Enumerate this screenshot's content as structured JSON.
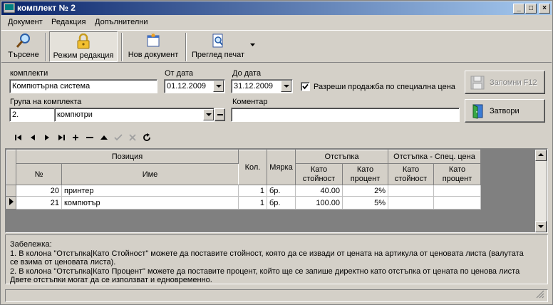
{
  "window": {
    "title": "комплект № 2"
  },
  "titlebar_buttons": {
    "minimize": "_",
    "maximize": "□",
    "close": "×"
  },
  "menu": [
    "Документ",
    "Редакция",
    "Допълнителни"
  ],
  "toolbar": {
    "search": "Търсене",
    "edit_mode": "Режим редакция",
    "new_document": "Нов документ",
    "print_preview": "Преглед печат"
  },
  "form": {
    "komplekti_label": "комплекти",
    "komplekti_value": "Компютърна система",
    "from_date_label": "От дата",
    "from_date_value": "01.12.2009",
    "to_date_label": "До дата",
    "to_date_value": "31.12.2009",
    "special_price_label": "Разреши продажба по специална цена",
    "special_price_checked": true,
    "group_label": "Група на комплекта",
    "group_code": "2.",
    "group_name": "компютри",
    "comment_label": "Коментар",
    "comment_value": ""
  },
  "buttons": {
    "save": "Запомни  F12",
    "close": "Затвори"
  },
  "grid": {
    "headers": {
      "position": "Позиция",
      "number": "№",
      "name": "Име",
      "qty": "Кол.",
      "unit": "Мярка",
      "discount": "Отстъпка",
      "discount_special": "Отстъпка - Спец. цена",
      "as_value": "Като стойност",
      "as_percent": "Като процент",
      "as_value_2": "Като стойност",
      "as_percent_2": "Като процент"
    },
    "rows": [
      {
        "num": "20",
        "name": "принтер",
        "qty": "1",
        "unit": "бр.",
        "val": "40.00",
        "pct": "2%",
        "sval": "",
        "spct": ""
      },
      {
        "num": "21",
        "name": "компютър",
        "qty": "1",
        "unit": "бр.",
        "val": "100.00",
        "pct": "5%",
        "sval": "",
        "spct": ""
      }
    ]
  },
  "note": {
    "title": "Забележка:",
    "line1": "1. В колона \"Отстъпка|Като Стойност\" можете да поставите стойност, която да се извади от цената на артикула от ценовата листа (валутата",
    "line2": "се взима от ценовата листа).",
    "line3": "2. В колона \"Отстъпка|Като Процент\" можете да поставите процент, който ще се запише директно като отстъпка от цената по ценова листа",
    "line4": "Двете отстъпки могат да се използват и едновременно."
  },
  "icons": {
    "search": "magnifier-icon",
    "edit_mode": "padlock-icon",
    "new_document": "new-document-icon",
    "print_preview": "print-preview-icon",
    "save": "floppy-disk-icon",
    "close": "door-exit-icon"
  }
}
